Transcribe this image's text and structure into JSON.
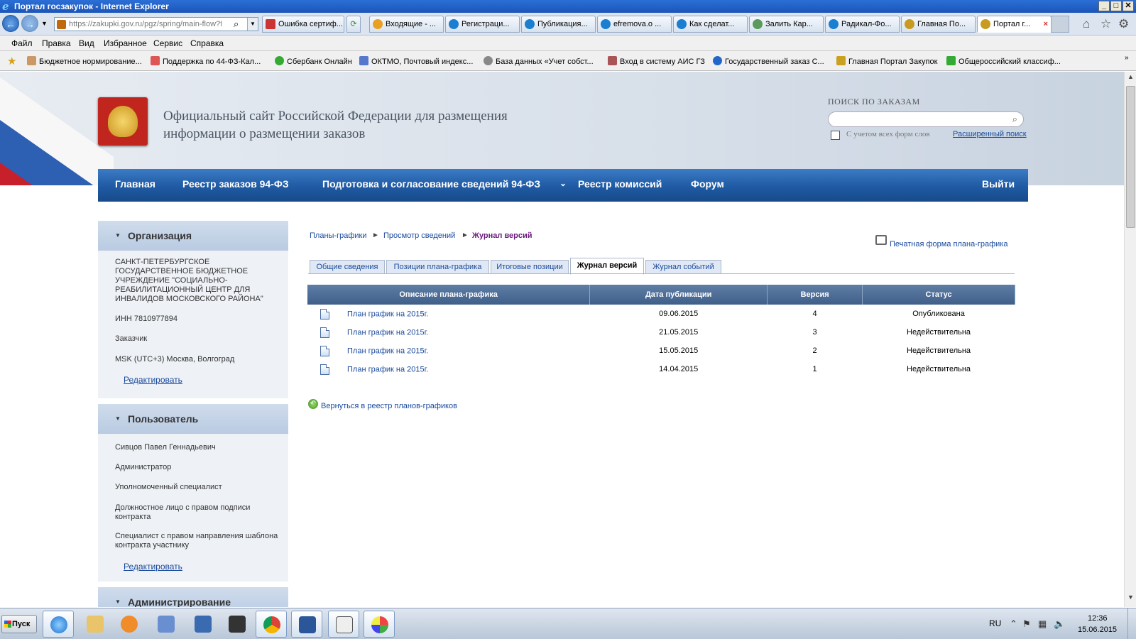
{
  "window": {
    "title": "Портал госзакупок - Internet Explorer",
    "min": "_",
    "max": "□",
    "close": "✕"
  },
  "browser": {
    "url": "https://zakupki.gov.ru/pgz/spring/main-flow?flo",
    "cert_error": "Ошибка сертиф...",
    "tabs": [
      {
        "label": "Входящие - ...",
        "color": "#e8a020"
      },
      {
        "label": "Регистраци...",
        "color": "#1a7fd0"
      },
      {
        "label": "Публикация...",
        "color": "#1a7fd0"
      },
      {
        "label": "efremova.o ...",
        "color": "#1a7fd0"
      },
      {
        "label": "Как сделат...",
        "color": "#1a7fd0"
      },
      {
        "label": "Залить Кар...",
        "color": "#5a9a5a"
      },
      {
        "label": "Радикал-Фо...",
        "color": "#1a7fd0"
      },
      {
        "label": "Главная По...",
        "color": "#c89a20"
      },
      {
        "label": "Портал г...",
        "color": "#c89a20"
      }
    ],
    "menu": [
      "Файл",
      "Правка",
      "Вид",
      "Избранное",
      "Сервис",
      "Справка"
    ],
    "favorites": [
      "Бюджетное нормирование...",
      "Поддержка по 44-ФЗ-Кал...",
      "Сбербанк Онлайн",
      "ОКТМО, Почтовый индекс...",
      "База данных «Учет собст...",
      "Вход в систему  АИС ГЗ",
      "Государственный заказ С...",
      "Главная Портал Закупок",
      "Общероссийский классиф..."
    ]
  },
  "site": {
    "title": "Официальный сайт Российской Федерации для размещения информации о размещении заказов",
    "search": {
      "label": "ПОИСК ПО ЗАКАЗАМ",
      "value": "",
      "checkbox_label": "С учетом всех форм слов",
      "advanced": "Расширенный поиск"
    },
    "nav": [
      "Главная",
      "Реестр заказов 94-ФЗ",
      "Подготовка и согласование сведений 94-ФЗ",
      "Реестр комиссий",
      "Форум"
    ],
    "nav_dropdown": "⌄",
    "logout": "Выйти"
  },
  "sidebar": {
    "org": {
      "title": "Организация",
      "name": "САНКТ-ПЕТЕРБУРГСКОЕ ГОСУДАРСТВЕННОЕ БЮДЖЕТНОЕ УЧРЕЖДЕНИЕ \"СОЦИАЛЬНО-РЕАБИЛИТАЦИОННЫЙ ЦЕНТР ДЛЯ ИНВАЛИДОВ МОСКОВСКОГО РАЙОНА\"",
      "inn": "ИНН 7810977894",
      "role": "Заказчик",
      "timezone": "MSK (UTC+3) Москва, Волгоград",
      "edit": "Редактировать"
    },
    "user": {
      "title": "Пользователь",
      "name": "Сивцов Павел Геннадьевич",
      "roles": [
        "Администратор",
        "Уполномоченный специалист",
        "Должностное лицо с правом подписи контракта",
        "Специалист с правом направления шаблона контракта участнику"
      ],
      "edit": "Редактировать"
    },
    "admin": {
      "title": "Администрирование"
    }
  },
  "content": {
    "breadcrumb": [
      "Планы-графики",
      "Просмотр сведений",
      "Журнал версий"
    ],
    "print_link": "Печатная форма плана-графика",
    "tabs": [
      "Общие сведения",
      "Позиции плана-графика",
      "Итоговые позиции",
      "Журнал версий",
      "Журнал событий"
    ],
    "active_tab": "Журнал версий",
    "table": {
      "headers": [
        "Описание плана-графика",
        "Дата публикации",
        "Версия",
        "Статус"
      ],
      "rows": [
        {
          "desc": "План график на 2015г.",
          "date": "09.06.2015",
          "version": "4",
          "status": "Опубликована"
        },
        {
          "desc": "План график на 2015г.",
          "date": "21.05.2015",
          "version": "3",
          "status": "Недействительна"
        },
        {
          "desc": "План график на 2015г.",
          "date": "15.05.2015",
          "version": "2",
          "status": "Недействительна"
        },
        {
          "desc": "План график на 2015г.",
          "date": "14.04.2015",
          "version": "1",
          "status": "Недействительна"
        }
      ]
    },
    "back_link": "Вернуться в реестр планов-графиков"
  },
  "taskbar": {
    "start": "Пуск",
    "lang": "RU",
    "time": "12:36",
    "date": "15.06.2015"
  }
}
